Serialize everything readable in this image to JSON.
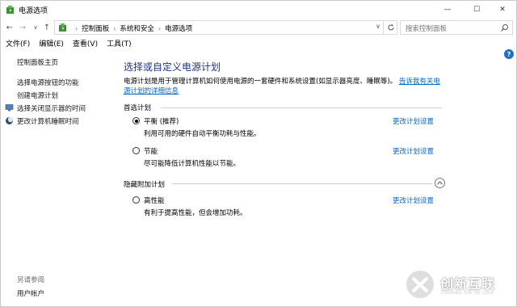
{
  "window": {
    "title": "电源选项",
    "controls": {
      "minimize": "—",
      "maximize": "☐",
      "close": "✕"
    }
  },
  "address": {
    "crumbs": [
      "控制面板",
      "系统和安全",
      "电源选项"
    ],
    "search_placeholder": "搜索控制面板"
  },
  "menu": [
    "文件(F)",
    "编辑(E)",
    "查看(V)",
    "工具(T)"
  ],
  "help": "?",
  "sidebar": {
    "home": "控制面板主页",
    "links": [
      "选择电源按钮的功能",
      "创建电源计划",
      "选择关闭显示器的时间",
      "更改计算机睡眠时间"
    ],
    "see_also_title": "另请参阅",
    "see_also_items": [
      "用户帐户"
    ]
  },
  "main": {
    "title": "选择或自定义电源计划",
    "description": "电源计划是用于管理计算机如何使用电源的一套硬件和系统设置(如显示器亮度、睡眠等)。",
    "description_link": "告诉我有关电源计划的详细信息",
    "preferred_header": "首选计划",
    "hidden_header": "隐藏附加计划",
    "change_label": "更改计划设置",
    "plans": [
      {
        "name": "平衡 (推荐)",
        "description": "利用可用的硬件自动平衡功耗与性能。",
        "selected": true
      },
      {
        "name": "节能",
        "description": "尽可能降低计算机性能以节能。",
        "selected": false
      },
      {
        "name": "高性能",
        "description": "有利于提高性能，但会增加功耗。",
        "selected": false
      }
    ]
  },
  "watermark": {
    "text": "创新互联",
    "subtext": "CHUANG XIN HU LIAN"
  },
  "colors": {
    "link": "#0066cc",
    "title": "#1e3287",
    "help": "#1f6fd0"
  }
}
